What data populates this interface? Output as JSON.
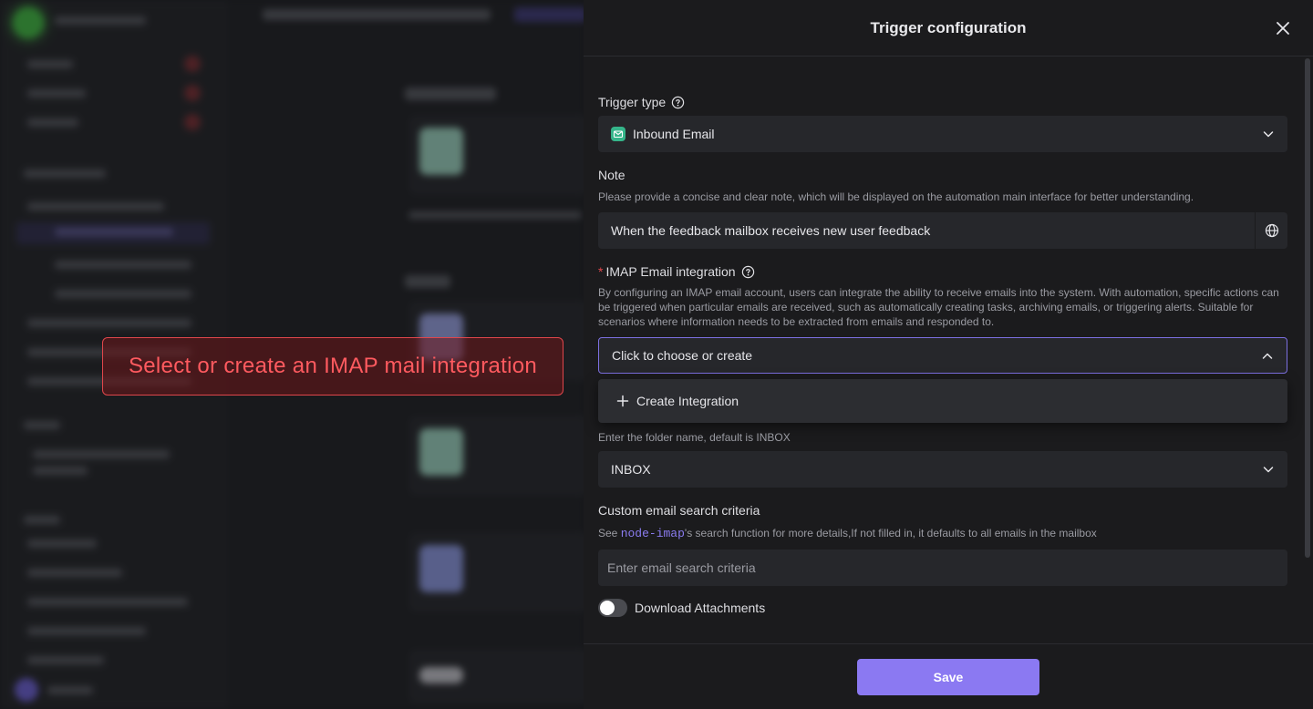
{
  "callout": {
    "text": "Select or create an IMAP mail integration"
  },
  "drawer": {
    "title": "Trigger configuration",
    "trigger_type": {
      "label": "Trigger type",
      "value": "Inbound Email"
    },
    "note": {
      "label": "Note",
      "description": "Please provide a concise and clear note, which will be displayed on the automation main interface for better understanding.",
      "value": "When the feedback mailbox receives new user feedback"
    },
    "imap": {
      "required_mark": "*",
      "label": "IMAP Email integration",
      "description": "By configuring an IMAP email account, users can integrate the ability to receive emails into the system. With automation, specific actions can be triggered when particular emails are received, such as automatically creating tasks, archiving emails, or triggering alerts. Suitable for scenarios where information needs to be extracted from emails and responded to.",
      "placeholder": "Click to choose or create",
      "dropdown_option": "Create Integration"
    },
    "folder": {
      "description": "Enter the folder name, default is INBOX",
      "value": "INBOX"
    },
    "search": {
      "label": "Custom email search criteria",
      "desc_prefix": "See ",
      "desc_link": "node-imap",
      "desc_suffix": "'s search function for more details,If not filled in, it defaults to all emails in the mailbox",
      "placeholder": "Enter email search criteria"
    },
    "attachments": {
      "label": "Download Attachments",
      "enabled": false
    },
    "save_label": "Save"
  },
  "colors": {
    "accent": "#8b79f2",
    "focus_border": "#7c6fe0",
    "callout": "#ff5a5f",
    "required": "#e0464b"
  },
  "icons": [
    "help-icon",
    "chevron-down-icon",
    "chevron-up-icon",
    "globe-icon",
    "plus-icon",
    "close-icon",
    "email-trigger-icon"
  ]
}
